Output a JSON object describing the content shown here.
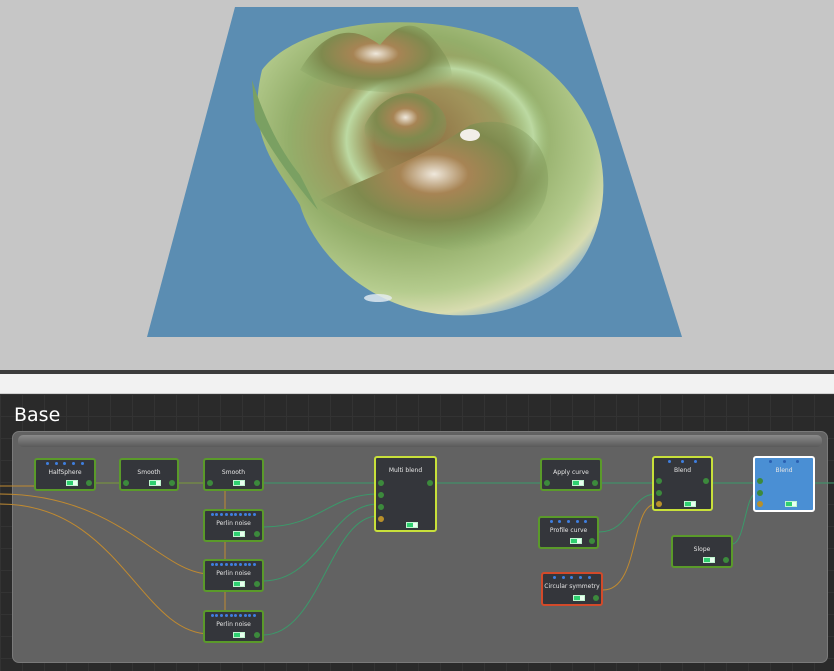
{
  "graph": {
    "title": "Base"
  },
  "nodes": [
    {
      "id": "n1",
      "label": "HalfSphere"
    },
    {
      "id": "n2",
      "label": "Smooth"
    },
    {
      "id": "n3",
      "label": "Smooth"
    },
    {
      "id": "n4",
      "label": "Perlin noise"
    },
    {
      "id": "n5",
      "label": "Perlin noise"
    },
    {
      "id": "n6",
      "label": "Perlin noise"
    },
    {
      "id": "n7",
      "label": "Multi blend"
    },
    {
      "id": "n8",
      "label": "Apply curve"
    },
    {
      "id": "n9",
      "label": "Profile curve"
    },
    {
      "id": "n10",
      "label": "Circular symmetry"
    },
    {
      "id": "n11",
      "label": "Blend"
    },
    {
      "id": "n12",
      "label": "Slope"
    },
    {
      "id": "n13",
      "label": "Blend"
    }
  ],
  "colors": {
    "node_border": "#5a9a2a",
    "selected_yellow": "#c8e03a",
    "error_red": "#d24a2a",
    "active_blue": "#4a8fd4",
    "port_dot": "#3f7fe0",
    "toggle_green": "#2fd070",
    "water": "#5b8db2"
  }
}
